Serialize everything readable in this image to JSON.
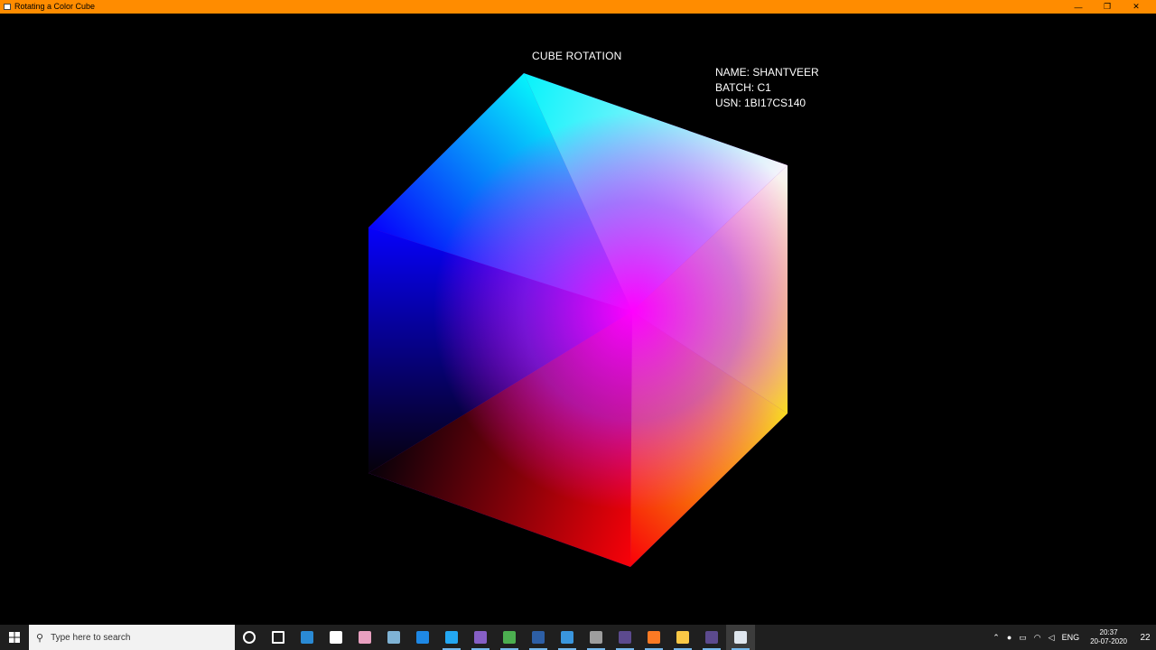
{
  "window": {
    "title": "Rotating a Color Cube",
    "minimize": "—",
    "maximize": "❐",
    "close": "✕"
  },
  "scene": {
    "heading": "CUBE ROTATION",
    "info": {
      "name": "NAME: SHANTVEER",
      "batch": "BATCH: C1",
      "usn": "USN: 1BI17CS140"
    }
  },
  "taskbar": {
    "search_placeholder": "Type here to search",
    "apps": [
      {
        "name": "cortana-icon",
        "color": "#ffffff"
      },
      {
        "name": "task-view-icon",
        "color": "#ffffff"
      },
      {
        "name": "mail-icon",
        "color": "#2a8ad4"
      },
      {
        "name": "store-icon",
        "color": "#ffffff"
      },
      {
        "name": "paint-icon",
        "color": "#e9a0c0"
      },
      {
        "name": "notes-icon",
        "color": "#7fb3d5"
      },
      {
        "name": "edge-icon",
        "color": "#1e88e5"
      },
      {
        "name": "vscode-icon",
        "color": "#23a7f2"
      },
      {
        "name": "visual-studio-icon",
        "color": "#865fc5"
      },
      {
        "name": "chrome-icon",
        "color": "#4caf50"
      },
      {
        "name": "powershell-icon",
        "color": "#2d5fa6"
      },
      {
        "name": "azure-studio-icon",
        "color": "#3a96dd"
      },
      {
        "name": "calculator-icon",
        "color": "#9e9e9e"
      },
      {
        "name": "eclipse-icon",
        "color": "#5c4a8e"
      },
      {
        "name": "xampp-icon",
        "color": "#fb7a24"
      },
      {
        "name": "file-explorer-icon",
        "color": "#f9c846"
      },
      {
        "name": "eclipse-2-icon",
        "color": "#5c4a8e"
      },
      {
        "name": "glut-window-icon",
        "color": "#dfe6ee"
      }
    ],
    "tray": {
      "language": "ENG",
      "time": "20:37",
      "date": "20-07-2020",
      "notifications": "22"
    }
  },
  "colors": {
    "titlebar": "#ff8c00",
    "background": "#000000",
    "taskbar": "#1f1f1f"
  }
}
